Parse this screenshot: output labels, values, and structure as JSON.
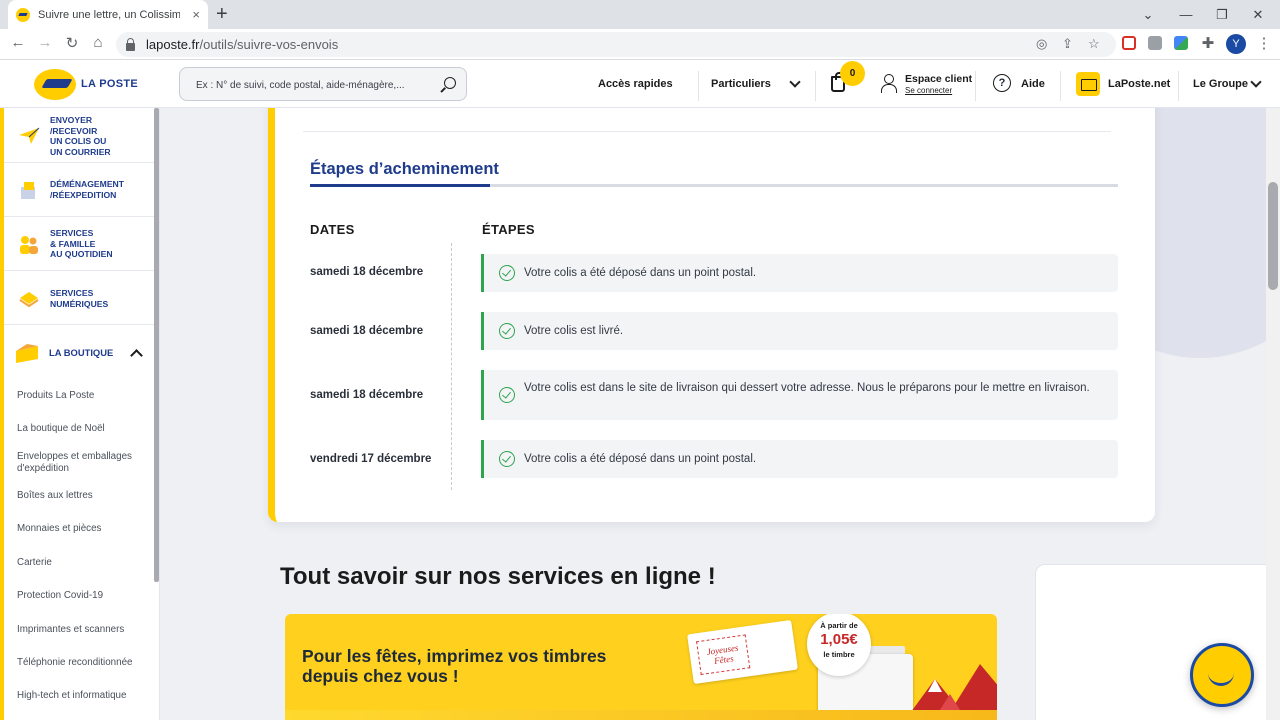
{
  "browser": {
    "tab_title": "Suivre une lettre, un Colissimo ou un Chronopost",
    "tab_close": "×",
    "new_tab": "+",
    "window_controls": [
      "⌄",
      "—",
      "❐",
      "✕"
    ],
    "url_domain": "laposte.fr",
    "url_path": "/outils/suivre-vos-envois",
    "profile_initial": "Y"
  },
  "header": {
    "logo_text": "LA POSTE",
    "search_placeholder": "Ex : N° de suivi, code postal, aide-ménagère,...",
    "quick_access": "Accès rapides",
    "segment": "Particuliers",
    "cart_count": "0",
    "account_label": "Espace client",
    "account_sub": "Se connecter",
    "help": "Aide",
    "mail_service": "LaPoste.net",
    "group": "Le Groupe"
  },
  "sidebar": {
    "categories": [
      {
        "label": "ENVOYER\n/RECEVOIR\nUN COLIS OU\nUN COURRIER",
        "icon": "paper-plane-icon"
      },
      {
        "label": "DÉMÉNAGEMENT\n/RÉEXPEDITION",
        "icon": "moving-boxes-icon"
      },
      {
        "label": "SERVICES\n& FAMILLE\nAU QUOTIDIEN",
        "icon": "family-icon"
      },
      {
        "label": "SERVICES\nNUMÉRIQUES",
        "icon": "digital-services-icon"
      },
      {
        "label": "LA BOUTIQUE",
        "icon": "shop-box-icon"
      }
    ],
    "boutique_items": [
      "Produits La Poste",
      "La boutique de Noël",
      "Enveloppes et emballages d'expédition",
      "Boîtes aux lettres",
      "Monnaies et pièces",
      "Carterie",
      "Protection Covid-19",
      "Imprimantes et scanners",
      "Téléphonie reconditionnée",
      "High-tech et informatique"
    ]
  },
  "tracking": {
    "section_title": "Étapes d’acheminement",
    "col_dates": "DATES",
    "col_steps": "ÉTAPES",
    "rows": [
      {
        "date": "samedi 18 décembre",
        "step": "Votre colis a été déposé dans un point postal."
      },
      {
        "date": "samedi 18 décembre",
        "step": "Votre colis est livré."
      },
      {
        "date": "samedi 18 décembre",
        "step": "Votre colis est dans le site de livraison qui dessert votre adresse. Nous le préparons pour le mettre en livraison."
      },
      {
        "date": "vendredi 17 décembre",
        "step": "Votre colis a été déposé dans un point postal."
      }
    ],
    "status_color": "#2ea44f"
  },
  "services": {
    "title": "Tout savoir sur nos services en ligne !",
    "promo_text": "Pour les fêtes, imprimez vos timbres\ndepuis chez vous !",
    "stamp_text": "Joyeuses Fêtes",
    "price_prefix": "À partir de",
    "price_value": "1,05€",
    "price_suffix": "le timbre"
  },
  "colors": {
    "brand_yellow": "#ffcd00",
    "brand_blue": "#1e3b8c"
  }
}
